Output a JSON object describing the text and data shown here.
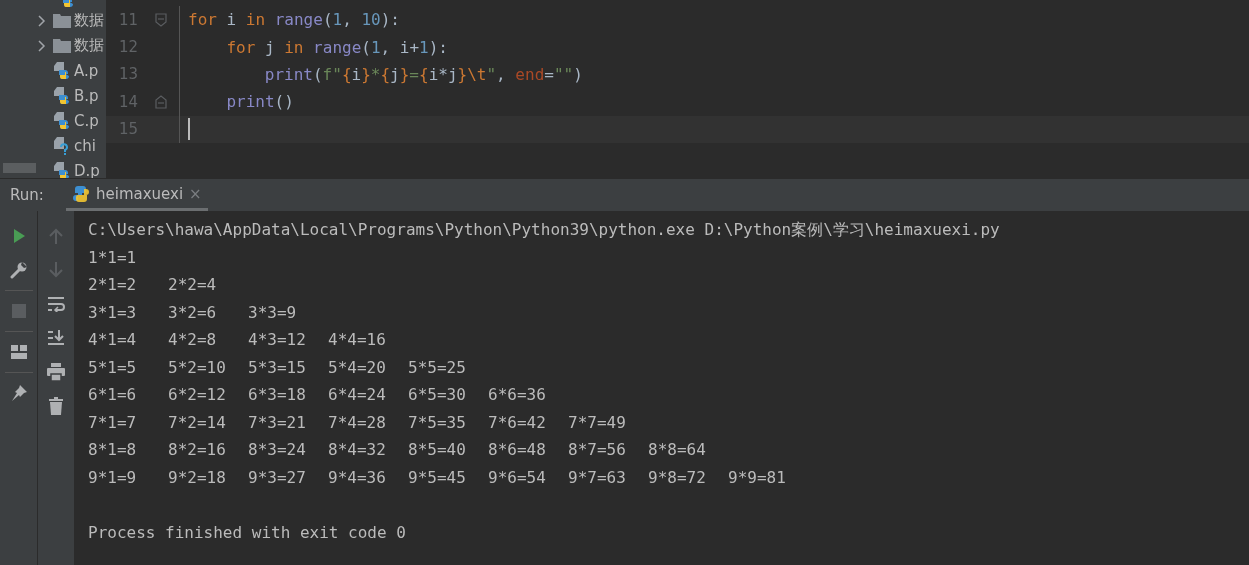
{
  "project_tree": {
    "items": [
      {
        "kind": "python",
        "cut_top": true
      },
      {
        "kind": "folder",
        "name": "数据",
        "expanded": false,
        "cut_top": false
      },
      {
        "kind": "folder",
        "name": "数据",
        "expanded": false,
        "cut_top": false
      },
      {
        "kind": "python",
        "name": "A.p",
        "cut_top": false
      },
      {
        "kind": "python",
        "name": "B.p",
        "cut_top": false
      },
      {
        "kind": "python",
        "name": "C.p",
        "cut_top": false
      },
      {
        "kind": "unknown",
        "name": "chi",
        "cut_top": false
      },
      {
        "kind": "python",
        "name": "D.p",
        "cut_top": false
      }
    ]
  },
  "editor": {
    "lines": [
      {
        "number": "11",
        "fold_start": true,
        "fold_end": false,
        "current": false,
        "tokens": [
          {
            "kind": "keyword",
            "text": "for"
          },
          {
            "kind": "plain",
            "text": " i "
          },
          {
            "kind": "keyword",
            "text": "in "
          },
          {
            "kind": "builtin",
            "text": "range"
          },
          {
            "kind": "plain",
            "text": "("
          },
          {
            "kind": "number",
            "text": "1"
          },
          {
            "kind": "plain",
            "text": ", "
          },
          {
            "kind": "number",
            "text": "10"
          },
          {
            "kind": "plain",
            "text": "):"
          }
        ],
        "children": [
          {
            "number": "12",
            "fold_start": false,
            "fold_end": false,
            "current": false,
            "tokens": [
              {
                "kind": "keyword",
                "text": "for"
              },
              {
                "kind": "plain",
                "text": " j "
              },
              {
                "kind": "keyword",
                "text": "in "
              },
              {
                "kind": "builtin",
                "text": "range"
              },
              {
                "kind": "plain",
                "text": "("
              },
              {
                "kind": "number",
                "text": "1"
              },
              {
                "kind": "plain",
                "text": ", i+"
              },
              {
                "kind": "number",
                "text": "1"
              },
              {
                "kind": "plain",
                "text": "):"
              }
            ],
            "children": [
              {
                "number": "13",
                "fold_start": false,
                "fold_end": false,
                "current": false,
                "tokens": [
                  {
                    "kind": "builtin",
                    "text": "print"
                  },
                  {
                    "kind": "plain",
                    "text": "("
                  },
                  {
                    "kind": "string",
                    "text": "f\""
                  },
                  {
                    "kind": "brace",
                    "text": "{"
                  },
                  {
                    "kind": "plain",
                    "text": "i"
                  },
                  {
                    "kind": "brace",
                    "text": "}"
                  },
                  {
                    "kind": "string",
                    "text": "*"
                  },
                  {
                    "kind": "brace",
                    "text": "{"
                  },
                  {
                    "kind": "plain",
                    "text": "j"
                  },
                  {
                    "kind": "brace",
                    "text": "}"
                  },
                  {
                    "kind": "string",
                    "text": "="
                  },
                  {
                    "kind": "brace",
                    "text": "{"
                  },
                  {
                    "kind": "plain",
                    "text": "i*j"
                  },
                  {
                    "kind": "brace",
                    "text": "}"
                  },
                  {
                    "kind": "escape",
                    "text": "\\t"
                  },
                  {
                    "kind": "string",
                    "text": "\""
                  },
                  {
                    "kind": "plain",
                    "text": ", "
                  },
                  {
                    "kind": "param",
                    "text": "end"
                  },
                  {
                    "kind": "plain",
                    "text": "="
                  },
                  {
                    "kind": "string",
                    "text": "\"\""
                  },
                  {
                    "kind": "plain",
                    "text": ")"
                  }
                ]
              }
            ]
          },
          {
            "number": "14",
            "fold_start": false,
            "fold_end": true,
            "current": false,
            "tokens": [
              {
                "kind": "builtin",
                "text": "print"
              },
              {
                "kind": "plain",
                "text": "()"
              }
            ]
          }
        ]
      },
      {
        "number": "15",
        "fold_start": false,
        "fold_end": false,
        "current": true
      }
    ]
  },
  "run_panel": {
    "label": "Run:",
    "tabs": [
      {
        "title": "heimaxuexi",
        "selected": true,
        "close": "×"
      }
    ],
    "left_toolbar": [
      {
        "kind": "rerun",
        "disabled": false
      },
      {
        "kind": "settings",
        "disabled": false
      },
      {
        "kind": "stop",
        "disabled": true
      },
      {
        "kind": "layout",
        "disabled": false
      },
      {
        "kind": "pin",
        "disabled": false
      }
    ],
    "right_toolbar": [
      {
        "kind": "up",
        "disabled": true
      },
      {
        "kind": "down",
        "disabled": true
      },
      {
        "kind": "wrap",
        "disabled": false
      },
      {
        "kind": "scroll-end",
        "disabled": false
      },
      {
        "kind": "print",
        "disabled": false
      },
      {
        "kind": "trash",
        "disabled": false
      }
    ],
    "console": {
      "command": "C:\\Users\\hawa\\AppData\\Local\\Programs\\Python\\Python39\\python.exe D:\\Python案例\\学习\\heimaxuexi.py",
      "rows": [
        [
          "1*1=1"
        ],
        [
          "2*1=2",
          "2*2=4"
        ],
        [
          "3*1=3",
          "3*2=6",
          "3*3=9"
        ],
        [
          "4*1=4",
          "4*2=8",
          "4*3=12",
          "4*4=16"
        ],
        [
          "5*1=5",
          "5*2=10",
          "5*3=15",
          "5*4=20",
          "5*5=25"
        ],
        [
          "6*1=6",
          "6*2=12",
          "6*3=18",
          "6*4=24",
          "6*5=30",
          "6*6=36"
        ],
        [
          "7*1=7",
          "7*2=14",
          "7*3=21",
          "7*4=28",
          "7*5=35",
          "7*6=42",
          "7*7=49"
        ],
        [
          "8*1=8",
          "8*2=16",
          "8*3=24",
          "8*4=32",
          "8*5=40",
          "8*6=48",
          "8*7=56",
          "8*8=64"
        ],
        [
          "9*1=9",
          "9*2=18",
          "9*3=27",
          "9*4=36",
          "9*5=45",
          "9*6=54",
          "9*7=63",
          "9*8=72",
          "9*9=81"
        ]
      ],
      "finish": "Process finished with exit code 0"
    }
  }
}
